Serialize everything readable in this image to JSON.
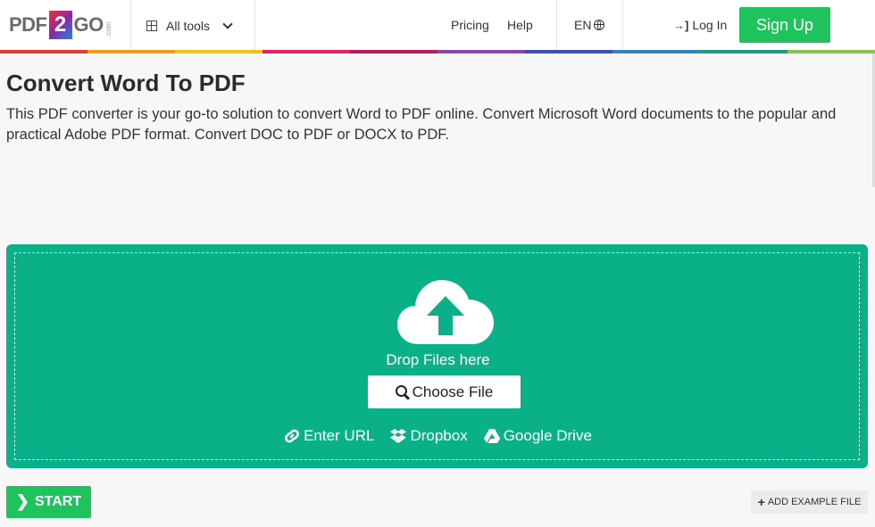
{
  "header": {
    "logo": {
      "pdf": "PDF",
      "two": "2",
      "go": "GO",
      "com": ".com"
    },
    "all_tools_label": "All tools",
    "pricing_label": "Pricing",
    "help_label": "Help",
    "language_label": "EN",
    "login_label": "Log In",
    "signup_label": "Sign Up"
  },
  "rainbow_colors": [
    "#e53935",
    "#f39c12",
    "#f1c40f",
    "#e91e63",
    "#c2185b",
    "#8e44ad",
    "#3f51b5",
    "#2e86c1",
    "#16a085",
    "#8bc34a"
  ],
  "page": {
    "title": "Convert Word To PDF",
    "description": "This PDF converter is your go-to solution to convert Word to PDF online. Convert Microsoft Word documents to the popular and practical Adobe PDF format. Convert DOC to PDF or DOCX to PDF."
  },
  "dropzone": {
    "drop_text": "Drop Files here",
    "choose_label": "Choose File",
    "sources": {
      "url_label": "Enter URL",
      "dropbox_label": "Dropbox",
      "gdrive_label": "Google Drive"
    },
    "icons": [
      "cloud-upload-icon",
      "search-icon",
      "link-icon",
      "dropbox-icon",
      "google-drive-icon"
    ]
  },
  "actions": {
    "start_label": "START",
    "example_label": "ADD EXAMPLE FILE"
  },
  "colors": {
    "accent_green": "#1ec35e",
    "dropzone_teal": "#0ab087"
  }
}
